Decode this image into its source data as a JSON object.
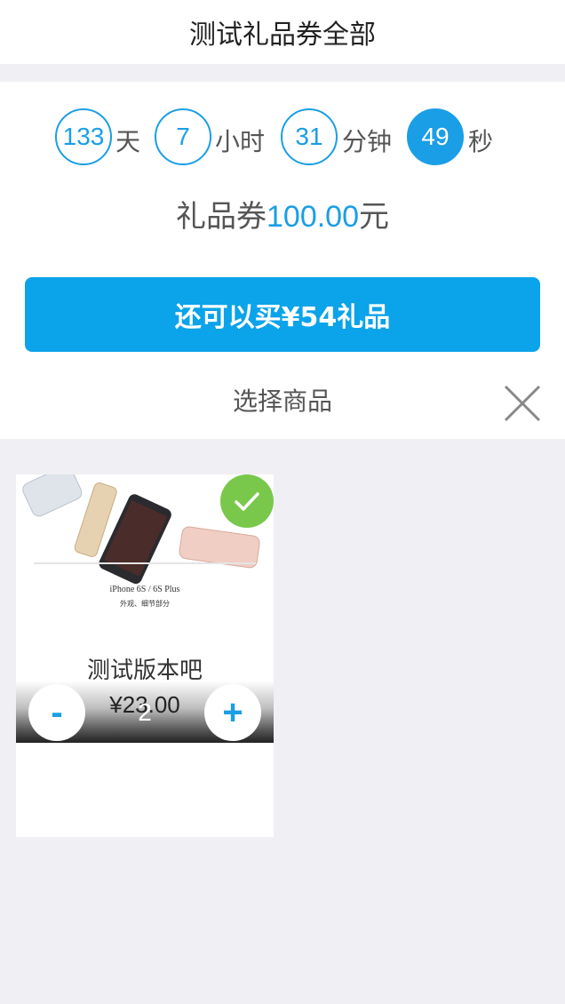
{
  "header": {
    "title": "测试礼品券全部"
  },
  "countdown": {
    "days": "133",
    "days_unit": "天",
    "hours": "7",
    "hours_unit": "小时",
    "minutes": "31",
    "minutes_unit": "分钟",
    "seconds": "49",
    "seconds_unit": "秒"
  },
  "voucher": {
    "prefix": "礼品券",
    "amount": "100.00",
    "suffix": "元"
  },
  "buy_button": {
    "label": "还可以买¥54礼品"
  },
  "select_section": {
    "label": "选择商品",
    "close_icon": "close-icon"
  },
  "products": [
    {
      "name": "测试版本吧",
      "price": "¥23.00",
      "quantity": "2",
      "selected": true,
      "image_caption": "iPhone 6S / 6S Plus",
      "image_subcaption": "外观、细节部分",
      "minus_label": "-",
      "plus_label": "+"
    }
  ],
  "colors": {
    "accent": "#0ba3ea",
    "check": "#7ac84b",
    "background": "#efeff4"
  }
}
